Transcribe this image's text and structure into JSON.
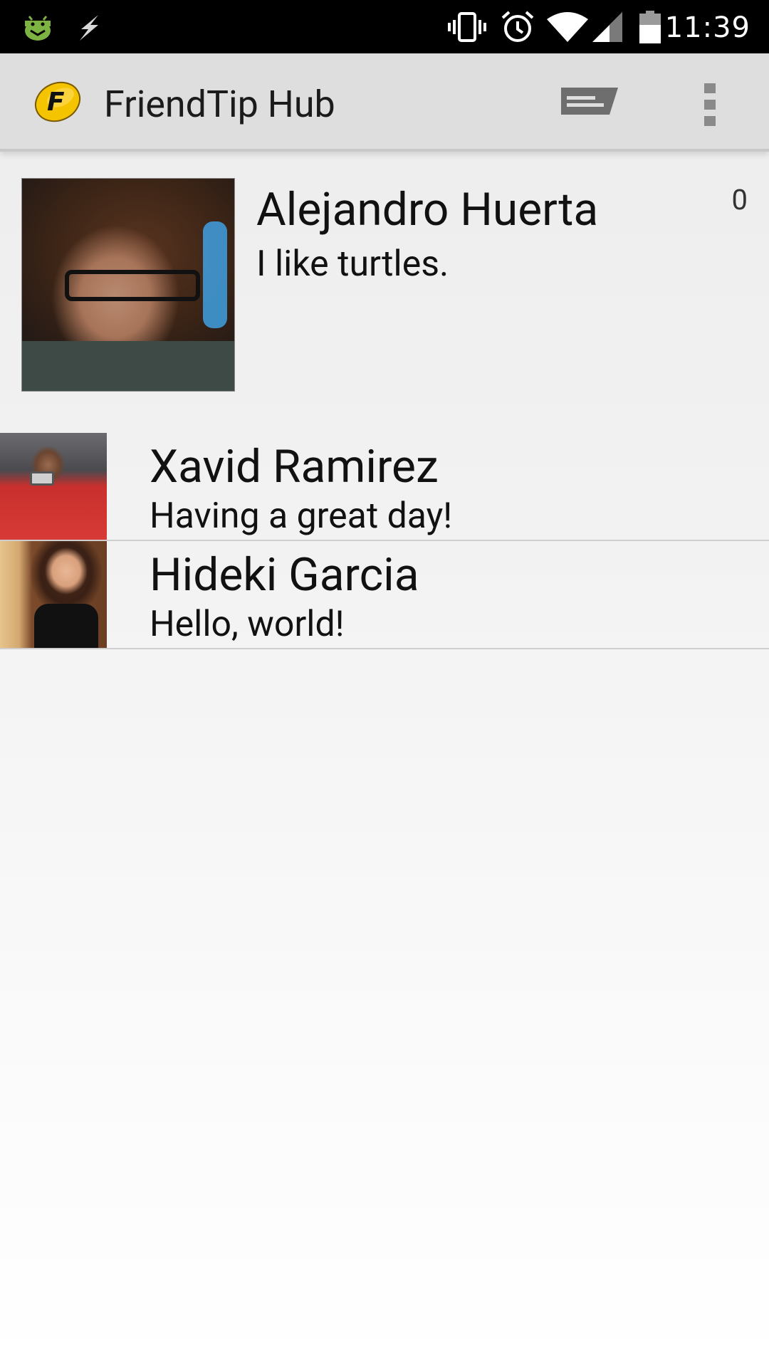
{
  "status_bar": {
    "time": "11:39",
    "icons": [
      "android-debug-icon",
      "bolt-icon",
      "vibrate-icon",
      "alarm-icon",
      "wifi-icon",
      "cell-signal-icon",
      "battery-icon"
    ]
  },
  "action_bar": {
    "title": "FriendTip Hub",
    "logo_letter": "F",
    "accent_color": "#f5c400"
  },
  "profile": {
    "name": "Alejandro Huerta",
    "status": "I like turtles.",
    "count": "0"
  },
  "friends": [
    {
      "name": "Xavid Ramirez",
      "status": "Having a great day!"
    },
    {
      "name": "Hideki Garcia",
      "status": "Hello, world!"
    }
  ]
}
